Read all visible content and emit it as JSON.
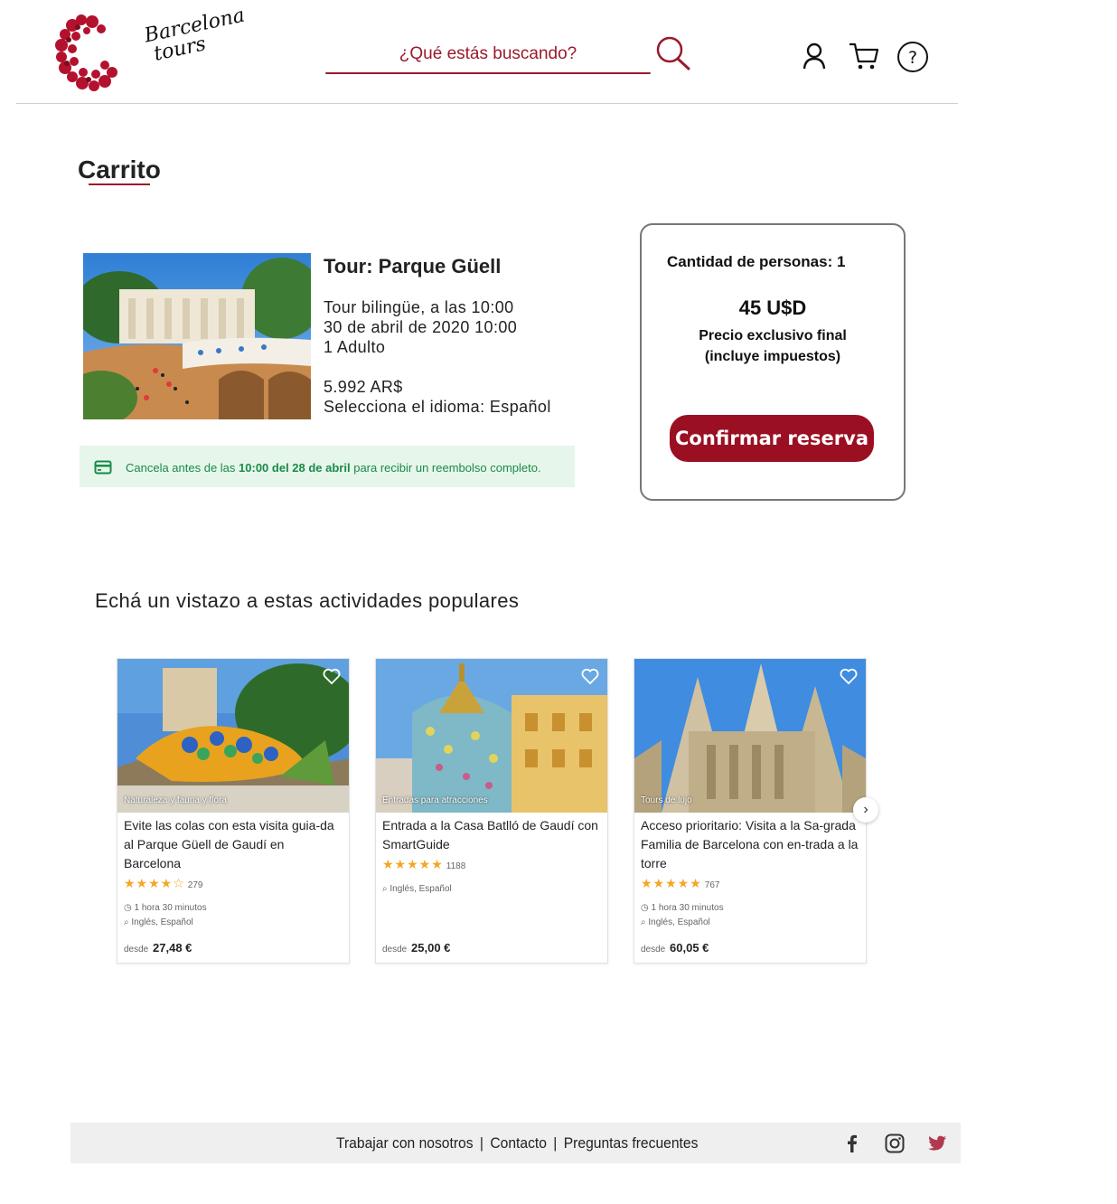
{
  "brand": {
    "logo_line1": "Barcelona",
    "logo_line2": "tours",
    "accent": "#9b1a2c"
  },
  "header": {
    "search_placeholder": "¿Qué estás buscando?",
    "icons": [
      "search-icon",
      "user-icon",
      "cart-icon",
      "help-icon"
    ]
  },
  "cart": {
    "title": "Carrito",
    "item": {
      "title": "Tour: Parque Güell",
      "lines": [
        "Tour bilingüe, a las 10:00",
        "30 de abril de 2020 10:00",
        "1 Adulto",
        "5.992 AR$",
        "Selecciona el idioma: Español"
      ]
    },
    "refund": {
      "prefix": "Cancela antes de las ",
      "deadline": "10:00 del 28 de abril",
      "suffix": " para recibir un reembolso completo.",
      "icon": "credit-card-icon"
    }
  },
  "summary": {
    "people": "Cantidad de personas: 1",
    "price": "45 U$D",
    "note_line1": "Precio exclusivo final",
    "note_line2": "(incluye impuestos)",
    "confirm_label": "Confirmar reserva",
    "button_color": "#9b0f22"
  },
  "popular": {
    "title": "Echá un vistazo a estas actividades populares",
    "cards": [
      {
        "category": "Naturaleza y fauna y flora",
        "title": "Evite las colas con esta visita guia-da al Parque Güell de Gaudí en Barcelona",
        "rating": 4,
        "stars": "★★★★☆",
        "reviews": "279",
        "duration": "1 hora 30 minutos",
        "languages": "Inglés, Español",
        "price_prefix": "desde",
        "price": "27,48 €"
      },
      {
        "category": "Entradas para atracciones",
        "title": "Entrada a la Casa Batlló de Gaudí con SmartGuide",
        "rating": 4.5,
        "stars": "★★★★★",
        "reviews": "1188",
        "duration": "",
        "languages": "Inglés, Español",
        "price_prefix": "desde",
        "price": "25,00 €"
      },
      {
        "category": "Tours de lujo",
        "title": "Acceso prioritario: Visita a la Sa-grada Familia de Barcelona con en-trada a la torre",
        "rating": 4.5,
        "stars": "★★★★★",
        "reviews": "767",
        "duration": "1 hora 30 minutos",
        "languages": "Inglés, Español",
        "price_prefix": "desde",
        "price": "60,05 €"
      }
    ]
  },
  "footer": {
    "links": [
      "Trabajar con nosotros",
      "Contacto",
      "Preguntas frecuentes"
    ],
    "separator": "|",
    "social": [
      "facebook-icon",
      "instagram-icon",
      "twitter-icon"
    ],
    "twitter_color": "#b2394d"
  }
}
